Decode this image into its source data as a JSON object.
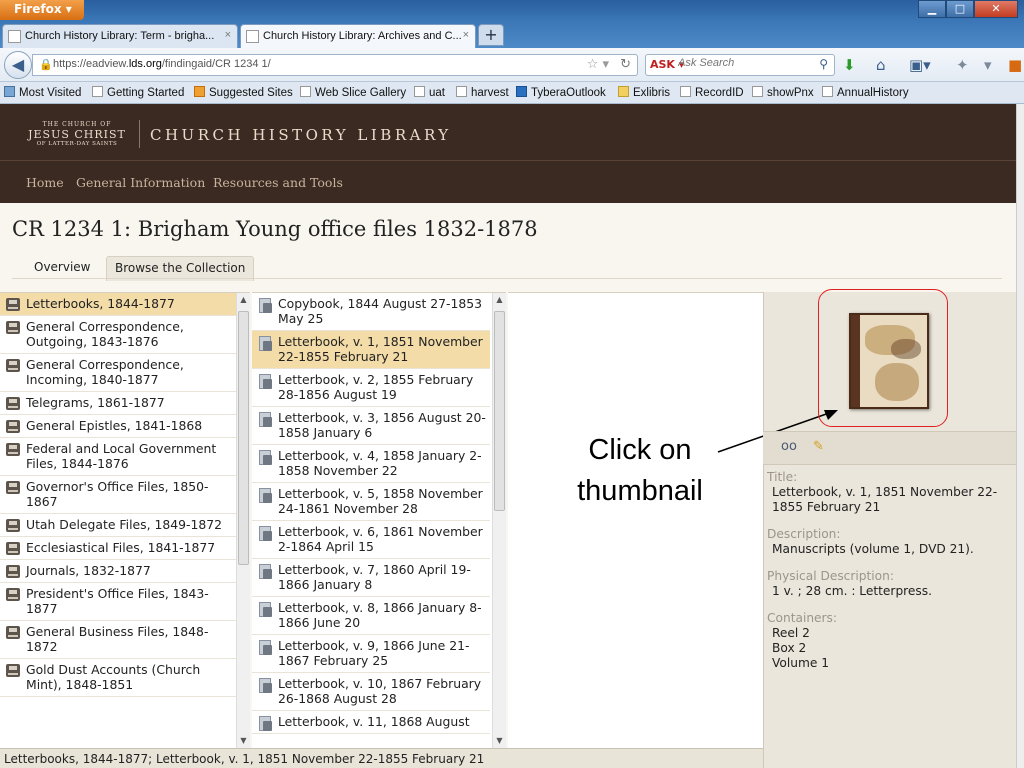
{
  "browser": {
    "app_button": "Firefox",
    "tabs": [
      {
        "label": "Church History Library: Term - brigha...",
        "close": "×"
      },
      {
        "label": "Church History Library: Archives and C...",
        "close": "×"
      }
    ],
    "new_tab": "+",
    "url_prefix": "https://eadview.",
    "url_domain": "lds.org",
    "url_path": "/findingaid/CR 1234 1/",
    "search_placeholder": "Ask Search",
    "bookmarks": [
      "Most Visited",
      "Getting Started",
      "Suggested Sites",
      "Web Slice Gallery",
      "uat",
      "harvest",
      "TyberaOutlook",
      "Exlibris",
      "RecordID",
      "showPnx",
      "AnnualHistory"
    ]
  },
  "site": {
    "logo_line1": "THE CHURCH OF",
    "logo_line2": "JESUS CHRIST",
    "logo_line3": "OF LATTER-DAY SAINTS",
    "name": "CHURCH HISTORY LIBRARY",
    "nav": [
      "Home",
      "General Information",
      "Resources and Tools"
    ]
  },
  "page": {
    "title": "CR 1234 1: Brigham Young office files 1832-1878",
    "tabs": [
      "Overview",
      "Browse the Collection"
    ],
    "active_tab": "Browse the Collection"
  },
  "series": [
    {
      "label": "Letterbooks, 1844-1877",
      "selected": true
    },
    {
      "label": "General Correspondence, Outgoing, 1843-1876"
    },
    {
      "label": "General Correspondence, Incoming, 1840-1877"
    },
    {
      "label": "Telegrams, 1861-1877"
    },
    {
      "label": "General Epistles, 1841-1868"
    },
    {
      "label": "Federal and Local Government Files, 1844-1876"
    },
    {
      "label": "Governor's Office Files, 1850-1867"
    },
    {
      "label": "Utah Delegate Files, 1849-1872"
    },
    {
      "label": "Ecclesiastical Files, 1841-1877"
    },
    {
      "label": "Journals, 1832-1877"
    },
    {
      "label": "President's Office Files, 1843-1877"
    },
    {
      "label": "General Business Files, 1848-1872"
    },
    {
      "label": "Gold Dust Accounts (Church Mint), 1848-1851"
    }
  ],
  "volumes": [
    {
      "label": "Copybook, 1844 August 27-1853 May 25"
    },
    {
      "label": "Letterbook, v. 1, 1851 November 22-1855 February 21",
      "selected": true
    },
    {
      "label": "Letterbook, v. 2, 1855 February 28-1856 August 19"
    },
    {
      "label": "Letterbook, v. 3, 1856 August 20-1858 January 6"
    },
    {
      "label": "Letterbook, v. 4, 1858 January 2-1858 November 22"
    },
    {
      "label": "Letterbook, v. 5, 1858 November 24-1861 November 28"
    },
    {
      "label": "Letterbook, v. 6, 1861 November 2-1864 April 15"
    },
    {
      "label": "Letterbook, v. 7, 1860 April 19-1866 January 8"
    },
    {
      "label": "Letterbook, v. 8, 1866 January 8-1866 June 20"
    },
    {
      "label": "Letterbook, v. 9, 1866 June 21-1867 February 25"
    },
    {
      "label": "Letterbook, v. 10, 1867 February 26-1868 August 28"
    },
    {
      "label": "Letterbook, v. 11, 1868 August"
    }
  ],
  "annotation": "Click on thumbnail",
  "details": {
    "title_label": "Title:",
    "title": "Letterbook, v. 1, 1851 November 22-1855 February 21",
    "description_label": "Description:",
    "description": "Manuscripts (volume 1, DVD 21).",
    "physical_label": "Physical Description:",
    "physical": "1 v. ; 28 cm. : Letterpress.",
    "containers_label": "Containers:",
    "containers": [
      "Reel 2",
      "Box 2",
      "Volume 1"
    ]
  },
  "status": "Letterbooks, 1844-1877; Letterbook, v. 1, 1851 November 22-1855 February 21",
  "colors": {
    "header": "#3b2a21",
    "selected_row": "#f3dca8",
    "annotation_border": "#e02020"
  }
}
